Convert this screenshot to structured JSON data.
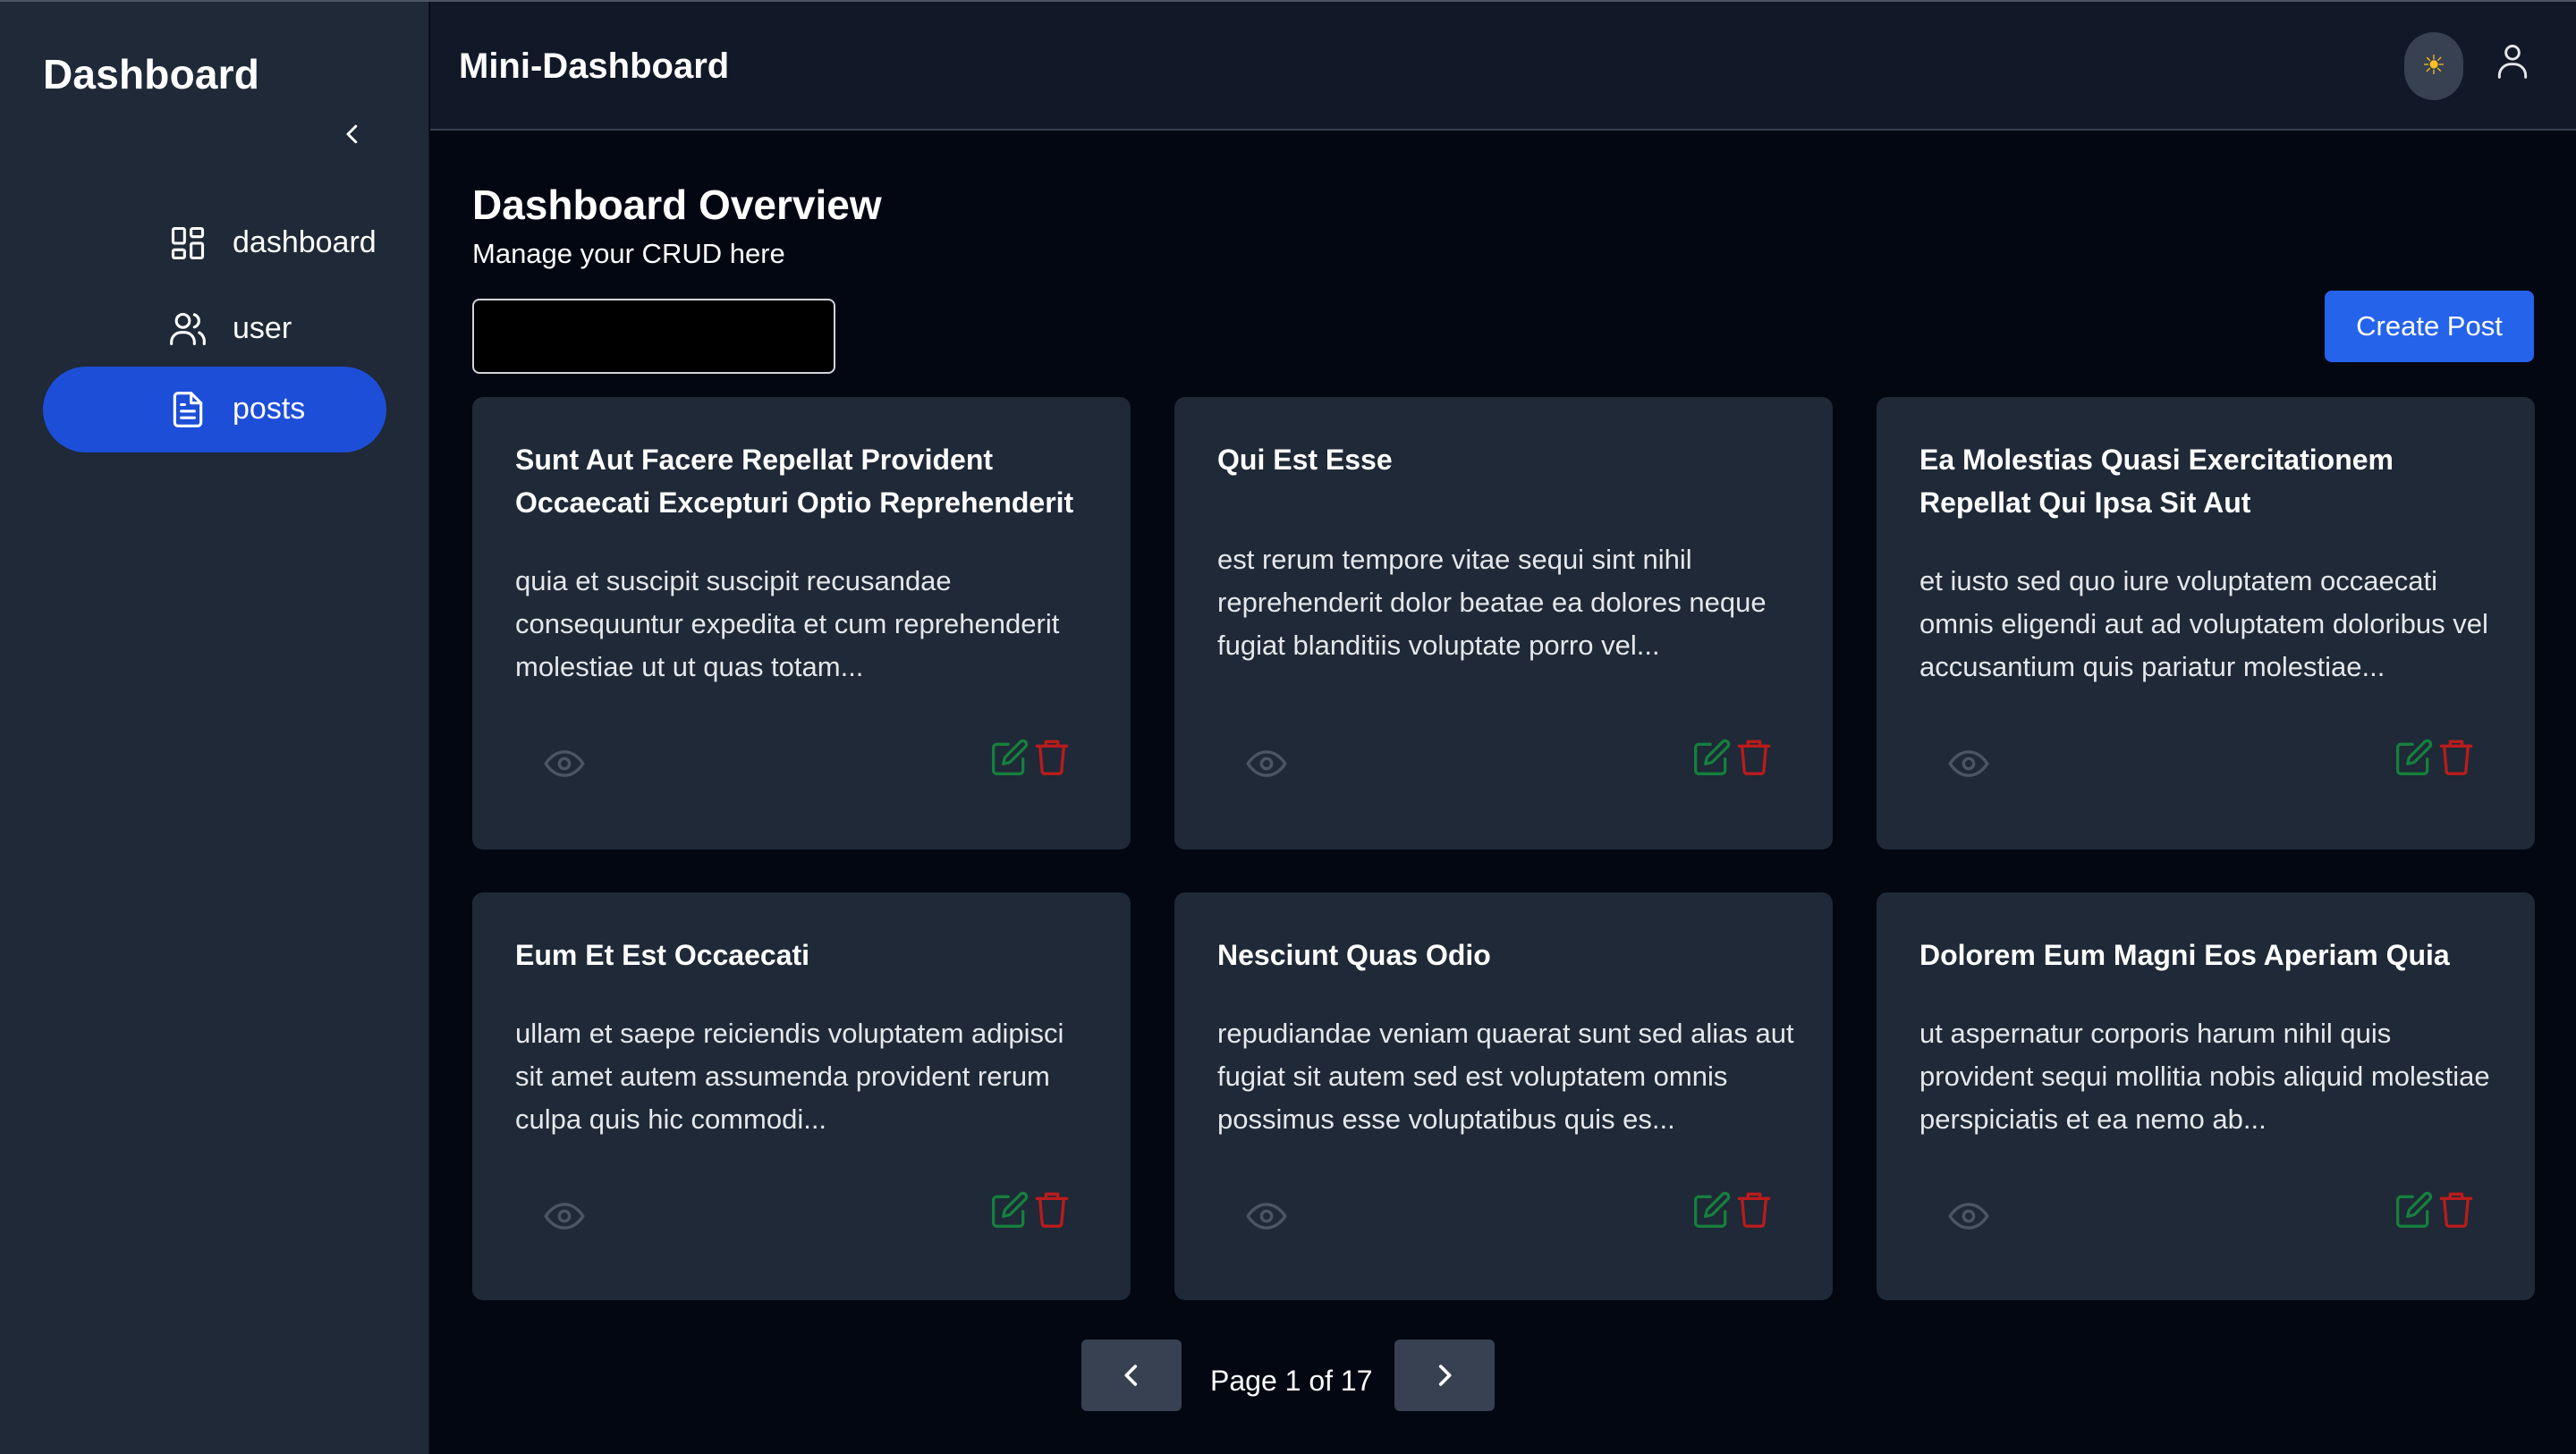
{
  "sidebar": {
    "brand": "Dashboard",
    "items": [
      {
        "label": "dashboard",
        "icon": "layout-grid-icon"
      },
      {
        "label": "user",
        "icon": "users-icon"
      },
      {
        "label": "posts",
        "icon": "file-text-icon",
        "active": true
      }
    ]
  },
  "header": {
    "title": "Mini-Dashboard",
    "theme_icon": "sun-icon",
    "profile_icon": "user-icon"
  },
  "main": {
    "title": "Dashboard Overview",
    "subtitle": "Manage your CRUD here",
    "search": {
      "value": "",
      "placeholder": ""
    },
    "create_label": "Create Post"
  },
  "posts": [
    {
      "title": "Sunt Aut Facere Repellat Provident Occaecati Excepturi Optio Reprehenderit",
      "body": "quia et suscipit suscipit recusandae consequuntur expedita et cum reprehenderit molestiae ut ut quas totam..."
    },
    {
      "title": "Qui Est Esse",
      "body": "est rerum tempore vitae sequi sint nihil reprehenderit dolor beatae ea dolores neque fugiat blanditiis voluptate porro vel..."
    },
    {
      "title": "Ea Molestias Quasi Exercitationem Repellat Qui Ipsa Sit Aut",
      "body": "et iusto sed quo iure voluptatem occaecati omnis eligendi aut ad voluptatem doloribus vel accusantium quis pariatur molestiae..."
    },
    {
      "title": "Eum Et Est Occaecati",
      "body": "ullam et saepe reiciendis voluptatem adipisci sit amet autem assumenda provident rerum culpa quis hic commodi..."
    },
    {
      "title": "Nesciunt Quas Odio",
      "body": "repudiandae veniam quaerat sunt sed alias aut fugiat sit autem sed est voluptatem omnis possimus esse voluptatibus quis es..."
    },
    {
      "title": "Dolorem Eum Magni Eos Aperiam Quia",
      "body": "ut aspernatur corporis harum nihil quis provident sequi mollitia nobis aliquid molestiae perspiciatis et ea nemo ab..."
    }
  ],
  "pagination": {
    "label": "Page 1 of 17"
  },
  "colors": {
    "accent": "#1d4ed8",
    "button": "#2563eb",
    "edit": "#15803d",
    "delete": "#b91c1c"
  }
}
